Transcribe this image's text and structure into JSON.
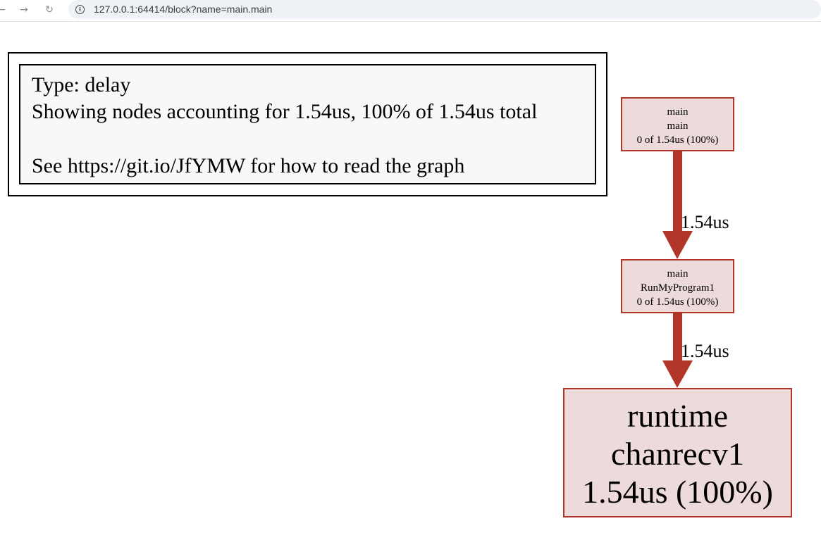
{
  "browser": {
    "back_icon": "arrow-left-icon",
    "forward_icon": "arrow-right-icon",
    "reload_icon": "reload-icon",
    "url": "127.0.0.1:64414/block?name=main.main"
  },
  "legend": {
    "line1": "Type: delay",
    "line2": "Showing nodes accounting for 1.54us, 100% of 1.54us total",
    "line3": "See https://git.io/JfYMW for how to read the graph"
  },
  "graph": {
    "colors": {
      "edge": "#b2352a",
      "node_fill": "#eddada",
      "node_border": "#b2352a"
    },
    "nodes": [
      {
        "line1": "main",
        "line2": "main",
        "line3": "0 of 1.54us (100%)"
      },
      {
        "line1": "main",
        "line2": "RunMyProgram1",
        "line3": "0 of 1.54us (100%)"
      },
      {
        "line1": "runtime",
        "line2": "chanrecv1",
        "line3": "1.54us (100%)"
      }
    ],
    "edges": [
      {
        "label": "1.54us"
      },
      {
        "label": "1.54us"
      }
    ]
  }
}
